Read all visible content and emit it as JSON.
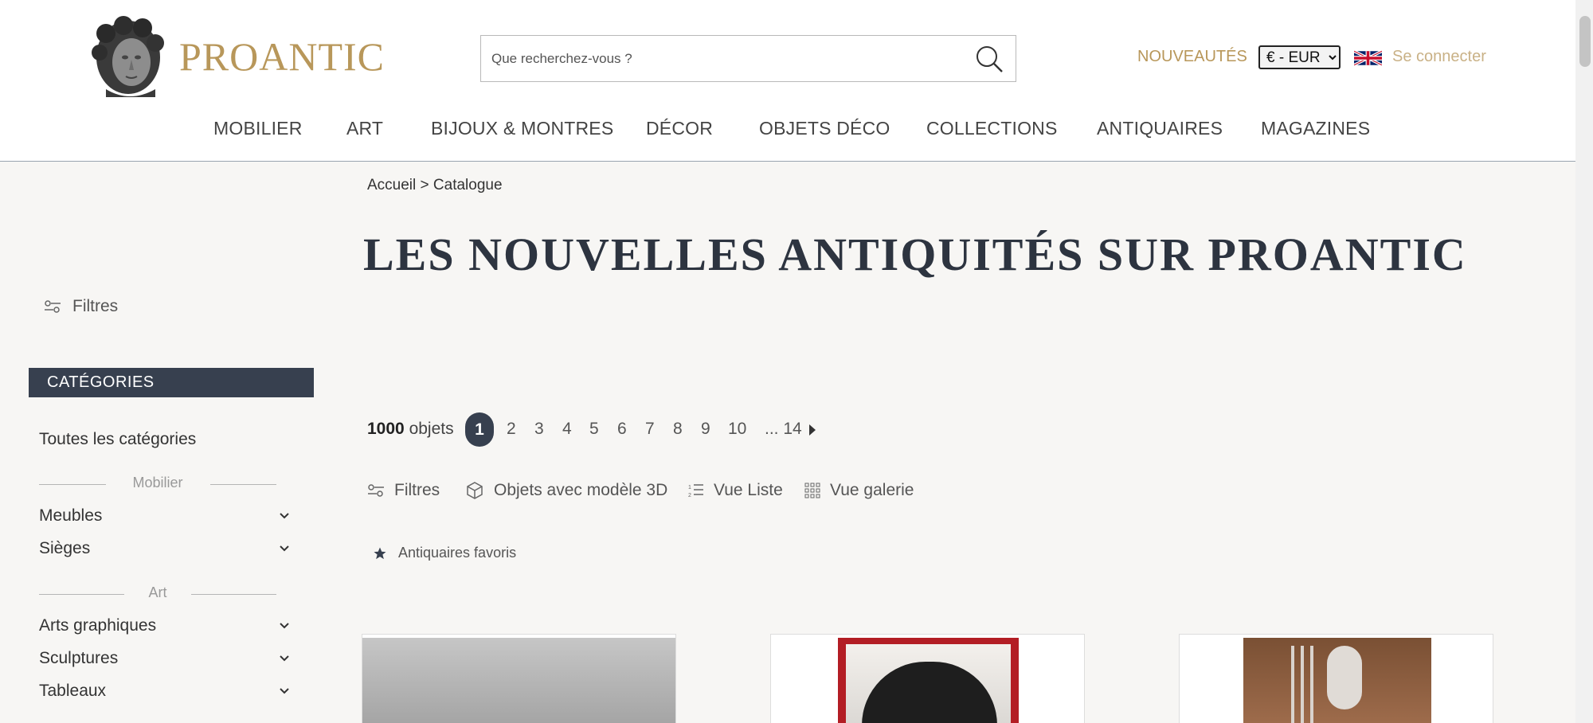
{
  "header": {
    "brand": "PROANTIC",
    "search_placeholder": "Que recherchez-vous ?",
    "nouveautes": "NOUVEAUTÉS",
    "currency_selected": "€ - EUR",
    "login": "Se connecter"
  },
  "nav": [
    "MOBILIER",
    "ART",
    "BIJOUX & MONTRES",
    "DÉCOR",
    "OBJETS DÉCO",
    "COLLECTIONS",
    "ANTIQUAIRES",
    "MAGAZINES"
  ],
  "breadcrumb": {
    "home": "Accueil",
    "sep": ">",
    "current": "Catalogue"
  },
  "page_title": "LES NOUVELLES ANTIQUITÉS SUR PROANTIC",
  "sidebar": {
    "filters_label": "Filtres",
    "categories_title": "CATÉGORIES",
    "all_categories": "Toutes les catégories",
    "groups": [
      {
        "label": "Mobilier",
        "items": [
          "Meubles",
          "Sièges"
        ]
      },
      {
        "label": "Art",
        "items": [
          "Arts graphiques",
          "Sculptures",
          "Tableaux"
        ]
      }
    ]
  },
  "results": {
    "count": "1000",
    "count_label": "objets",
    "current_page": "1",
    "pages": [
      "2",
      "3",
      "4",
      "5",
      "6",
      "7",
      "8",
      "9",
      "10"
    ],
    "ellipsis_last": "... 14"
  },
  "toolbar": {
    "filters": "Filtres",
    "models_3d": "Objets avec modèle 3D",
    "list_view": "Vue Liste",
    "gallery_view": "Vue galerie",
    "favorite_dealers": "Antiquaires favoris"
  },
  "colors": {
    "brand_gold": "#b8975a",
    "dark_slate": "#37404f",
    "background": "#f7f6f4"
  }
}
